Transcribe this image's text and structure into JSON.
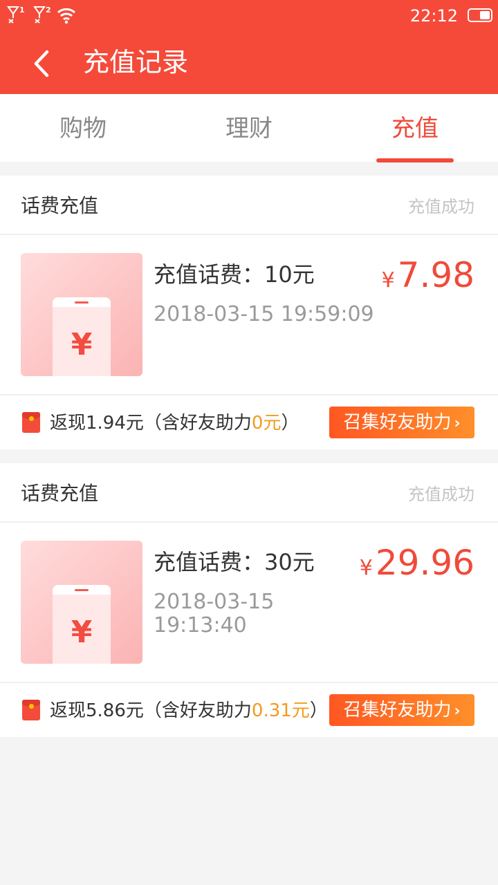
{
  "status_bar": {
    "sim1": "1",
    "sim2": "2",
    "time": "22:12",
    "icons": [
      "signal-sim1-icon",
      "signal-sim2-icon",
      "wifi-icon",
      "battery-icon"
    ]
  },
  "header": {
    "title": "充值记录",
    "back_icon": "chevron-left-icon"
  },
  "tabs": [
    {
      "label": "购物",
      "active": false
    },
    {
      "label": "理财",
      "active": false
    },
    {
      "label": "充值",
      "active": true
    }
  ],
  "colors": {
    "brand": "#f54a3a",
    "price": "#f04a3a",
    "highlight": "#f39a1e"
  },
  "records": [
    {
      "type": "话费充值",
      "status": "充值成功",
      "name": "充值话费：10元",
      "date": "2018-03-15 19:59:09",
      "currency": "¥",
      "price": "7.98",
      "cashback_prefix": "返现1.94元（含好友助力",
      "cashback_amount": "0元",
      "cashback_suffix": "）",
      "button_label": "召集好友助力",
      "thumb_symbol": "¥"
    },
    {
      "type": "话费充值",
      "status": "充值成功",
      "name": "充值话费：30元",
      "date": "2018-03-15 19:13:40",
      "currency": "¥",
      "price": "29.96",
      "cashback_prefix": "返现5.86元（含好友助力",
      "cashback_amount": "0.31元",
      "cashback_suffix": "）",
      "button_label": "召集好友助力",
      "thumb_symbol": "¥"
    }
  ]
}
